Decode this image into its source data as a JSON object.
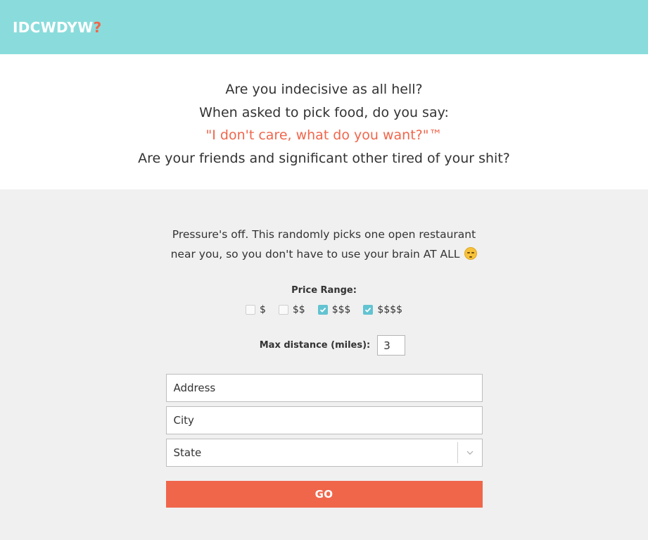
{
  "header": {
    "logo_text": "IDCWDYW",
    "logo_mark": "?",
    "colors": {
      "background": "#8adcdc",
      "accent": "#f0664b"
    }
  },
  "hero": {
    "line1": "Are you indecisive as all hell?",
    "line2": "When asked to pick food, do you say:",
    "line3": "\"I don't care, what do you want?\"™",
    "line4": "Are your friends and significant other tired of your shit?"
  },
  "main": {
    "blurb_line1": "Pressure's off. This randomly picks one open restaurant",
    "blurb_line2": "near you, so you don't have to use your brain AT ALL",
    "blurb_emoji": "smirk-emoji",
    "price_label": "Price Range:",
    "price_options": [
      {
        "label": "$",
        "checked": false
      },
      {
        "label": "$$",
        "checked": false
      },
      {
        "label": "$$$",
        "checked": true
      },
      {
        "label": "$$$$",
        "checked": true
      }
    ],
    "distance_label": "Max distance (miles):",
    "distance_value": "3",
    "address_placeholder": "Address",
    "city_placeholder": "City",
    "state_value": "State",
    "go_label": "GO",
    "colors": {
      "checkbox_checked": "#62c3d1",
      "button": "#f0664b"
    }
  }
}
